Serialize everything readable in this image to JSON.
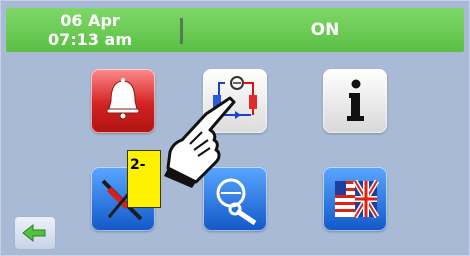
{
  "header": {
    "date": "06 Apr",
    "time": "07:13 am",
    "status": "ON"
  },
  "tiles": [
    {
      "name": "alarm",
      "icon": "bell-icon"
    },
    {
      "name": "refrigeration-circuit",
      "icon": "refrigeration-circuit-icon"
    },
    {
      "name": "information",
      "icon": "info-icon"
    },
    {
      "name": "tools",
      "icon": "screwdriver-wrench-icon"
    },
    {
      "name": "service",
      "icon": "compressor-wrench-icon"
    },
    {
      "name": "language",
      "icon": "uk-flag-icon"
    }
  ],
  "back_button": {
    "icon": "left-arrow-icon"
  },
  "annotation": {
    "step_label": "2-"
  },
  "colors": {
    "header_green": "#5cbf45",
    "background": "#a9bad6",
    "step_label_yellow": "#fff200"
  }
}
